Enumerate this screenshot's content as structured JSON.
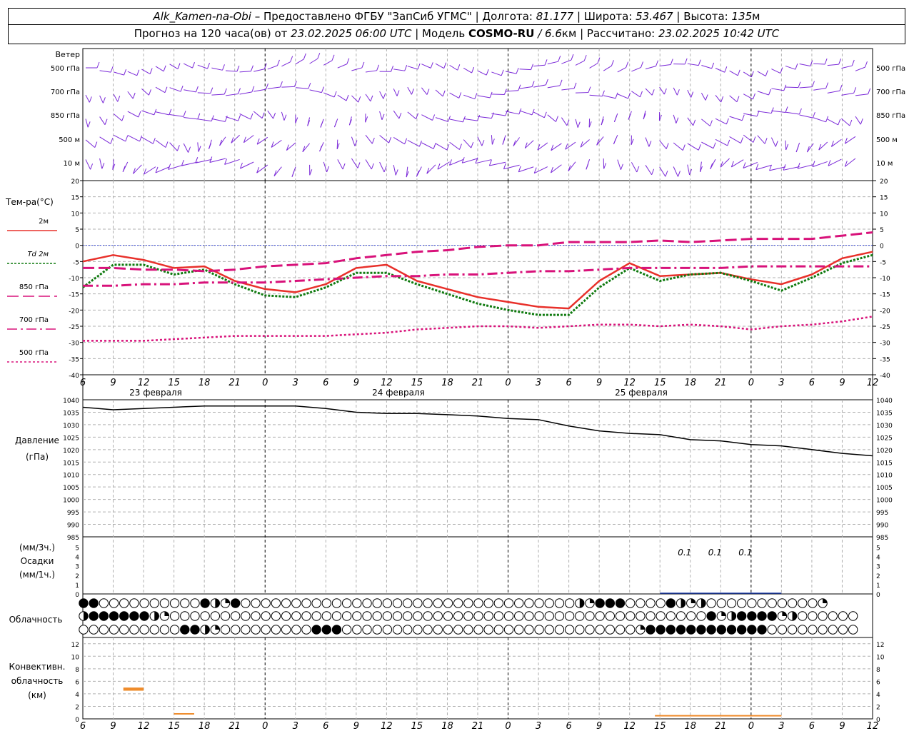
{
  "header": {
    "line1": {
      "station": "Alk_Kamen-na-Obi",
      "provided": "– Предоставлено ФГБУ \"ЗапСиб УГМС\"",
      "lon_label": "| Долгота:",
      "lon_value": "81.177",
      "lat_label": "| Широта:",
      "lat_value": "53.467",
      "alt_label": "| Высота:",
      "alt_value": "135",
      "alt_unit": "м"
    },
    "line2": {
      "forecast_label": "Прогноз на 120 часа(ов) от",
      "forecast_time": "23.02.2025 06:00 UTC",
      "model_label": "| Модель",
      "model_name": "COSMO-RU",
      "model_res": "/ 6.6",
      "model_res_unit": "км",
      "calc_label": "| Рассчитано:",
      "calc_time": "23.02.2025 10:42 UTC"
    }
  },
  "time_axis": {
    "hour_labels": [
      "6",
      "9",
      "12",
      "15",
      "18",
      "21",
      "0",
      "3",
      "6",
      "9",
      "12",
      "15",
      "18",
      "21",
      "0",
      "3",
      "6",
      "9",
      "12",
      "15",
      "18",
      "21",
      "0",
      "3",
      "6",
      "9",
      "12"
    ],
    "day_labels": [
      "23 февраля",
      "24 февраля",
      "25 февраля"
    ]
  },
  "wind_panel": {
    "title": "Ветер",
    "levels": [
      "500 гПа",
      "700 гПа",
      "850 гПа",
      "500 м",
      "10 м"
    ]
  },
  "temp_panel": {
    "title": "Тем-ра(°С)",
    "legend": [
      {
        "label": "2м",
        "color": "#e8302a",
        "style": "solid"
      },
      {
        "label": "Td  2м",
        "color": "#0f7a0f",
        "style": "dotted"
      },
      {
        "label": "850 гПа",
        "color": "#d8127a",
        "style": "dash"
      },
      {
        "label": "700 гПа",
        "color": "#d8127a",
        "style": "dashdot"
      },
      {
        "label": "500 гПа",
        "color": "#d8127a",
        "style": "dot"
      }
    ],
    "ticks": [
      "20",
      "15",
      "10",
      "5",
      "0",
      "-5",
      "-10",
      "-15",
      "-20",
      "-25",
      "-30",
      "-35",
      "-40"
    ]
  },
  "pressure_panel": {
    "title1": "Давление",
    "title2": "(гПа)",
    "ticks": [
      "1040",
      "1035",
      "1030",
      "1025",
      "1020",
      "1015",
      "1010",
      "1005",
      "1000",
      "995",
      "990",
      "985"
    ]
  },
  "precip_panel": {
    "title1": "(мм/3ч.)",
    "title2": "Осадки",
    "title3": "(мм/1ч.)",
    "ticks": [
      "5",
      "4",
      "3",
      "2",
      "1",
      "0"
    ],
    "amounts": [
      "0.1",
      "0.1",
      "0.1"
    ]
  },
  "cloud_panel": {
    "title": "Облачность"
  },
  "conv_panel": {
    "title1": "Конвективн.",
    "title2": "облачность",
    "title3": "(км)",
    "ticks": [
      "12",
      "10",
      "8",
      "6",
      "4",
      "2",
      "0"
    ]
  },
  "chart_data": [
    {
      "type": "line",
      "panel": "temperature",
      "x_hours": [
        6,
        9,
        12,
        15,
        18,
        21,
        24,
        27,
        30,
        33,
        36,
        39,
        42,
        45,
        48,
        51,
        54,
        57,
        60,
        63,
        66,
        69,
        72,
        75,
        78,
        81,
        84
      ],
      "ylim": [
        -40,
        20
      ],
      "series": [
        {
          "name": "2м",
          "values": [
            -5,
            -3,
            -4.5,
            -7,
            -6.5,
            -11,
            -13.5,
            -14.5,
            -12,
            -7,
            -6,
            -11,
            -13.5,
            -16,
            -17.5,
            -19,
            -19.5,
            -11,
            -5.5,
            -9.5,
            -9,
            -8.5,
            -10.5,
            -12,
            -9,
            -4,
            -2
          ]
        },
        {
          "name": "Td  2м",
          "values": [
            -13,
            -6,
            -6,
            -9,
            -7.5,
            -12,
            -15.5,
            -16,
            -13,
            -8.5,
            -8.5,
            -12,
            -15,
            -18,
            -20,
            -21.5,
            -21.5,
            -13,
            -7,
            -11,
            -9,
            -8.5,
            -11,
            -14,
            -10,
            -5.5,
            -3
          ]
        },
        {
          "name": "850 гПа",
          "values": [
            -7,
            -7,
            -7.5,
            -7.5,
            -8,
            -7.5,
            -6.5,
            -6,
            -5.5,
            -4,
            -3,
            -2,
            -1.5,
            -0.5,
            0,
            0,
            1,
            1,
            1,
            1.5,
            1,
            1.5,
            2,
            2,
            2,
            3,
            4
          ]
        },
        {
          "name": "700 гПа",
          "values": [
            -12.5,
            -12.5,
            -12,
            -12,
            -11.5,
            -11.5,
            -11.5,
            -11,
            -10.5,
            -10,
            -9.5,
            -9.5,
            -9,
            -9,
            -8.5,
            -8,
            -8,
            -7.5,
            -7,
            -7,
            -7,
            -7,
            -6.5,
            -6.5,
            -6.5,
            -6.5,
            -6.5
          ]
        },
        {
          "name": "500 гПа",
          "values": [
            -29.5,
            -29.5,
            -29.5,
            -29,
            -28.5,
            -28,
            -28,
            -28,
            -28,
            -27.5,
            -27,
            -26,
            -25.5,
            -25,
            -25,
            -25.5,
            -25,
            -24.5,
            -24.5,
            -25,
            -24.5,
            -25,
            -26,
            -25,
            -24.5,
            -23.5,
            -22
          ]
        }
      ]
    },
    {
      "type": "line",
      "panel": "pressure",
      "x_hours": [
        6,
        9,
        12,
        15,
        18,
        21,
        24,
        27,
        30,
        33,
        36,
        39,
        42,
        45,
        48,
        51,
        54,
        57,
        60,
        63,
        66,
        69,
        72,
        75,
        78,
        81,
        84
      ],
      "ylim": [
        985,
        1040
      ],
      "series": [
        {
          "name": "Давление",
          "values": [
            1037,
            1036,
            1036.5,
            1037,
            1037.5,
            1037.5,
            1037.5,
            1037.5,
            1036.5,
            1035,
            1034.5,
            1034.5,
            1034,
            1033.5,
            1032.5,
            1032,
            1029.5,
            1027.5,
            1026.5,
            1026,
            1024,
            1023.5,
            1022,
            1021.5,
            1020,
            1018.5,
            1017.5
          ]
        }
      ]
    },
    {
      "type": "bar",
      "panel": "convective",
      "ylim": [
        0,
        13
      ],
      "series": [
        {
          "name": "Конвективн. облачность",
          "bars": [
            {
              "x_start": 10,
              "x_end": 12,
              "base": 4.5,
              "top": 5
            },
            {
              "x_start": 15,
              "x_end": 17,
              "base": 0.8,
              "top": 0.8
            },
            {
              "x_start": 62.5,
              "x_end": 75,
              "base": 0.5,
              "top": 0.5
            }
          ]
        }
      ]
    }
  ],
  "cloud_rows": {
    "top": "33000000000032130000000000000000000000000000000002133300003212000000000001",
    "middle": "23333332100000000000000000000000000000000000000000000000000000312333312000000",
    "bottom": "00000000003321000000000333000000000000000000000000000001333333333333000000000"
  },
  "colors": {
    "temp": "#e8302a",
    "dew": "#0f7a0f",
    "upper": "#d8127a",
    "wind": "#7a28d8",
    "pressure": "#000000",
    "conv": "#ef8c2c",
    "zero": "#3a4ad8"
  }
}
